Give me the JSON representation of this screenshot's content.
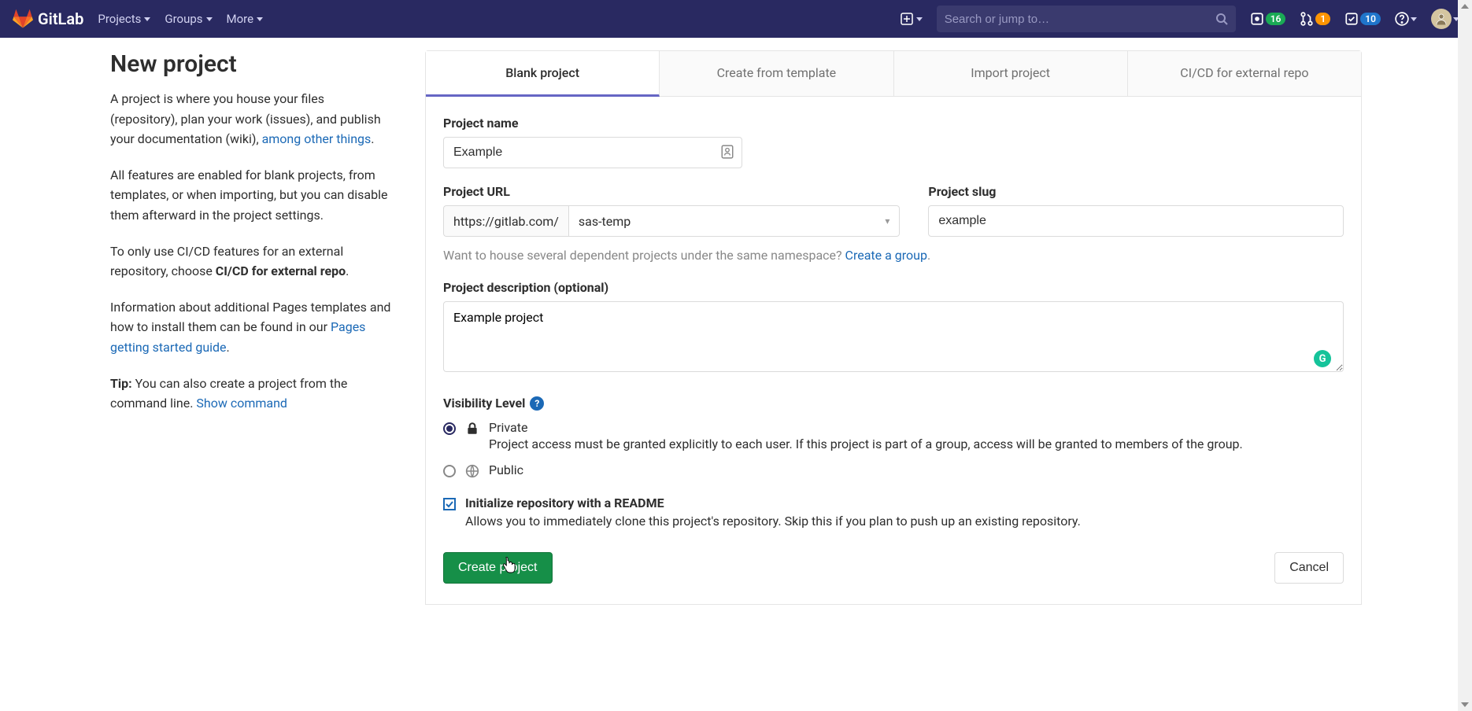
{
  "header": {
    "brand": "GitLab",
    "nav": {
      "projects": "Projects",
      "groups": "Groups",
      "more": "More"
    },
    "search_placeholder": "Search or jump to…",
    "badges": {
      "issues": "16",
      "mrs": "1",
      "todos": "10"
    }
  },
  "sidebar": {
    "title": "New project",
    "p1_a": "A project is where you house your files (repository), plan your work (issues), and publish your documentation (wiki), ",
    "p1_link": "among other things",
    "p1_b": ".",
    "p2": "All features are enabled for blank projects, from templates, or when importing, but you can disable them afterward in the project settings.",
    "p3_a": "To only use CI/CD features for an external repository, choose ",
    "p3_strong": "CI/CD for external repo",
    "p3_b": ".",
    "p4_a": "Information about additional Pages templates and how to install them can be found in our ",
    "p4_link": "Pages getting started guide",
    "p4_b": ".",
    "p5_tip": "Tip:",
    "p5_a": " You can also create a project from the command line. ",
    "p5_link": "Show command"
  },
  "tabs": {
    "blank": "Blank project",
    "template": "Create from template",
    "import": "Import project",
    "cicd": "CI/CD for external repo"
  },
  "form": {
    "name_label": "Project name",
    "name_value": "Example",
    "url_label": "Project URL",
    "url_addon": "https://gitlab.com/",
    "namespace": "sas-temp",
    "slug_label": "Project slug",
    "slug_value": "example",
    "group_hint_a": "Want to house several dependent projects under the same namespace? ",
    "group_hint_link": "Create a group",
    "group_hint_b": ".",
    "desc_label": "Project description (optional)",
    "desc_value": "Example project",
    "vis_label": "Visibility Level",
    "vis_private": "Private",
    "vis_private_desc": "Project access must be granted explicitly to each user. If this project is part of a group, access will be granted to members of the group.",
    "vis_public": "Public",
    "readme_label": "Initialize repository with a README",
    "readme_desc": "Allows you to immediately clone this project's repository. Skip this if you plan to push up an existing repository.",
    "submit": "Create project",
    "cancel": "Cancel"
  }
}
